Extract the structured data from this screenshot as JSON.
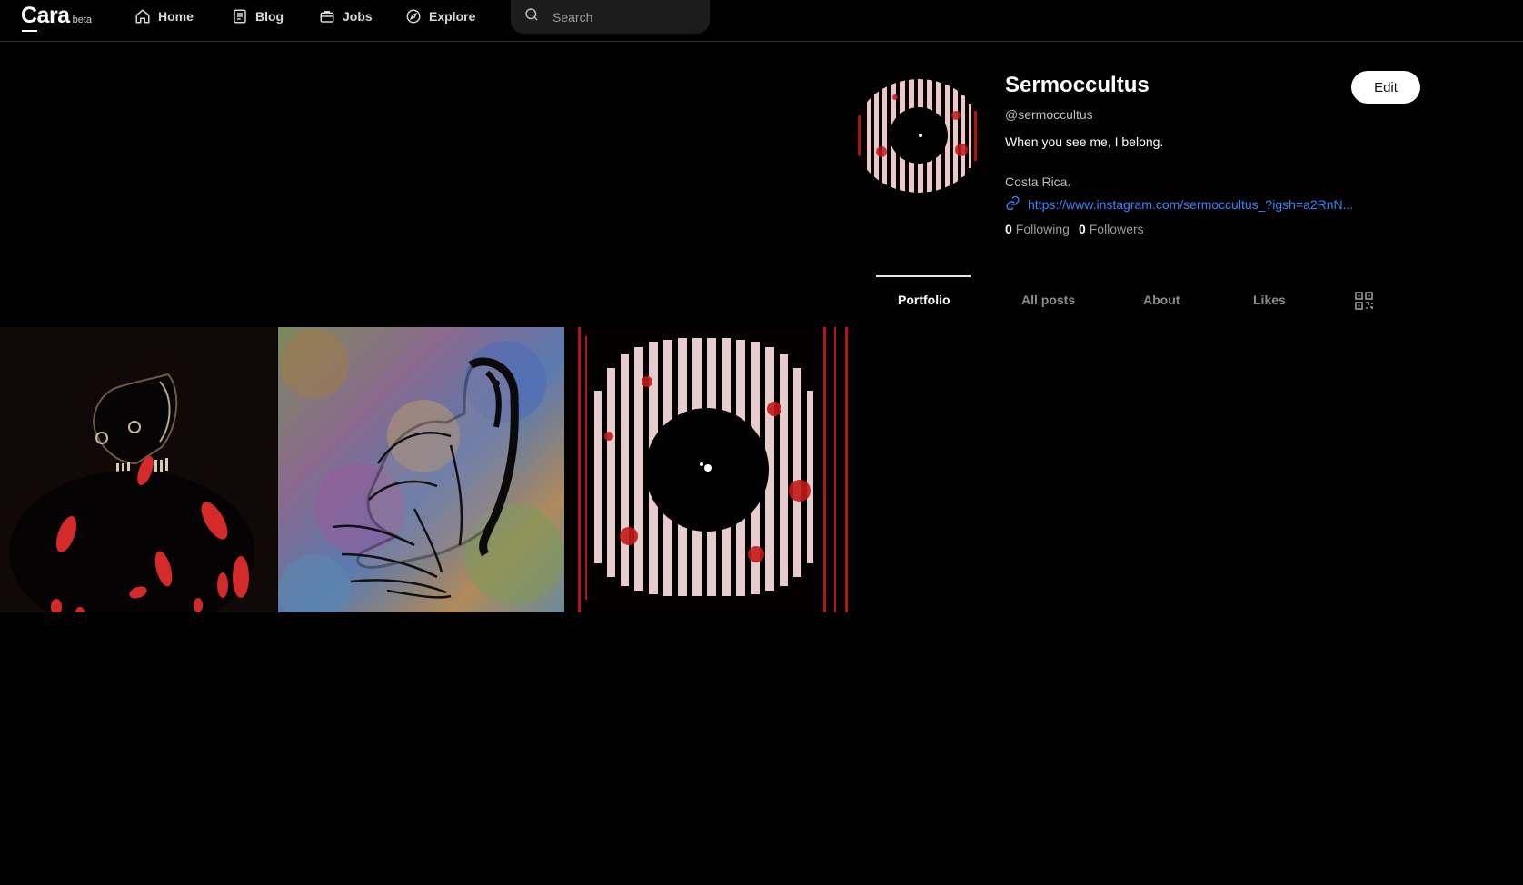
{
  "app": {
    "logo": "Cara",
    "logo_badge": "beta"
  },
  "nav": {
    "items": [
      {
        "label": "Home",
        "icon": "home-icon"
      },
      {
        "label": "Blog",
        "icon": "blog-icon"
      },
      {
        "label": "Jobs",
        "icon": "briefcase-icon"
      },
      {
        "label": "Explore",
        "icon": "compass-icon"
      }
    ],
    "search_placeholder": "Search"
  },
  "profile": {
    "name": "Sermoccultus",
    "handle": "@sermoccultus",
    "bio": "When you see me, I belong.",
    "location": "Costa Rica.",
    "link": "https://www.instagram.com/sermoccultus_?igsh=a2RnN...",
    "following_count": "0",
    "following_label": "Following",
    "followers_count": "0",
    "followers_label": "Followers",
    "edit_label": "Edit"
  },
  "tabs": [
    {
      "label": "Portfolio",
      "active": true
    },
    {
      "label": "All posts",
      "active": false
    },
    {
      "label": "About",
      "active": false
    },
    {
      "label": "Likes",
      "active": false
    }
  ],
  "portfolio": {
    "items": [
      {
        "subject": "dark skull figure with red spots"
      },
      {
        "subject": "line drawing of crouching figure on colorful noise"
      },
      {
        "subject": "black circle over striped red and white pattern"
      }
    ]
  },
  "colors": {
    "background": "#000000",
    "accent_link": "#3b82f6",
    "search_bg": "#1c1c1c",
    "artwork_red": "#d42a2a"
  }
}
